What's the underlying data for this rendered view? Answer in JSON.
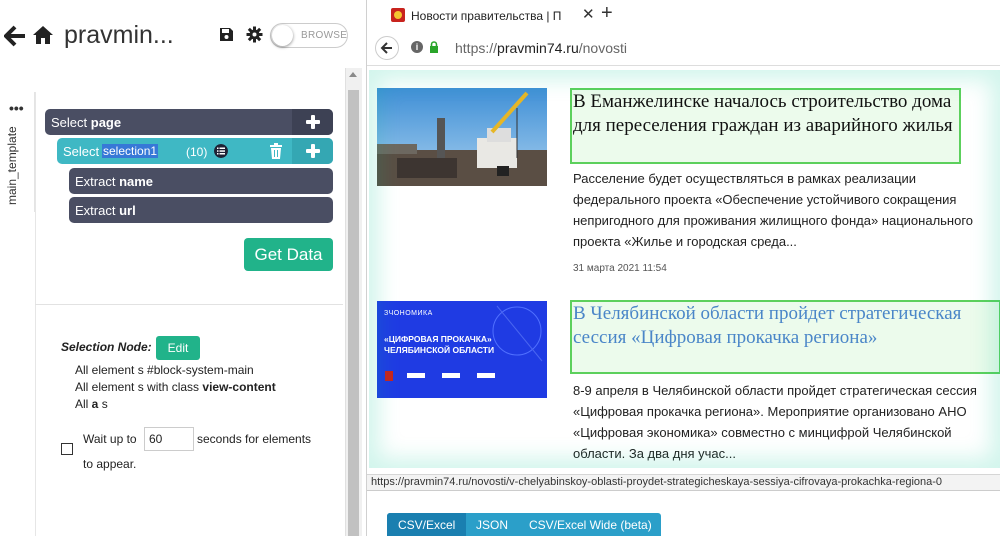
{
  "app": {
    "title": "pravmin...",
    "browse_label": "BROWSE",
    "tab_label": "main_template",
    "tab_dots": "•••"
  },
  "rows": {
    "page_pre": "Select ",
    "page_name": "page",
    "sel_pre": "Select",
    "sel_name": "selection1",
    "sel_count": "(10)",
    "ext1_pre": "Extract ",
    "ext1_name": "name",
    "ext2_pre": "Extract ",
    "ext2_name": "url"
  },
  "get_data_label": "Get Data",
  "selection_node": {
    "label": "Selection Node:",
    "edit_label": "Edit",
    "line1": "All element s #block-system-main",
    "line2_pre": "All element s with class ",
    "line2_bold": "view-content",
    "line3_pre": "All ",
    "line3_bold": "a",
    "line3_post": " s"
  },
  "wait": {
    "pre": "Wait up to",
    "value": "60",
    "post": "seconds for elements",
    "post2": "to appear."
  },
  "browser": {
    "tab_title": "Новости правительства | П",
    "tab_close": "✕",
    "tab_new": "+",
    "url_scheme": "https://",
    "url_host": "pravmin74.ru",
    "url_path": "/novosti"
  },
  "articles": [
    {
      "headline": "В Еманжелинске началось строительство дома для переселения граждан из аварийного жилья",
      "teaser": "Расселение будет осуществляться в рамках реализации федерального проекта «Обеспечение устойчивого сокращения непригодного для проживания жилищного фонда» национального проекта «Жилье и городская среда...",
      "date": "31 марта 2021 11:54"
    },
    {
      "headline": "В Челябинской области пройдет стратегическая сессия «Цифровая прокачка региона»",
      "teaser": "8-9 апреля в Челябинской области пройдет стратегическая сессия «Цифровая прокачка региона». Мероприятие организовано АНО «Цифровая экономика» совместно с минцифрой Челябинской области. За два дня учас..."
    }
  ],
  "banner": {
    "brand": "ЗЧОНОМИКА",
    "title": "«ЦИФРОВАЯ ПРОКАЧКА» ЧЕЛЯБИНСКОЙ ОБЛАСТИ"
  },
  "status_url": "https://pravmin74.ru/novosti/v-chelyabinskoy-oblasti-proydet-strategicheskaya-sessiya-cifrovaya-prokachka-regiona-0",
  "exports": [
    "CSV/Excel",
    "JSON",
    "CSV/Excel Wide (beta)"
  ],
  "colors": {
    "dark_row": "#4a4e63",
    "teal_row": "#3fb8c4",
    "green_btn": "#21b38a",
    "highlight_border": "#5cd05c",
    "link_blue": "#4a86c8",
    "export_blue": "#2b9fc9"
  }
}
